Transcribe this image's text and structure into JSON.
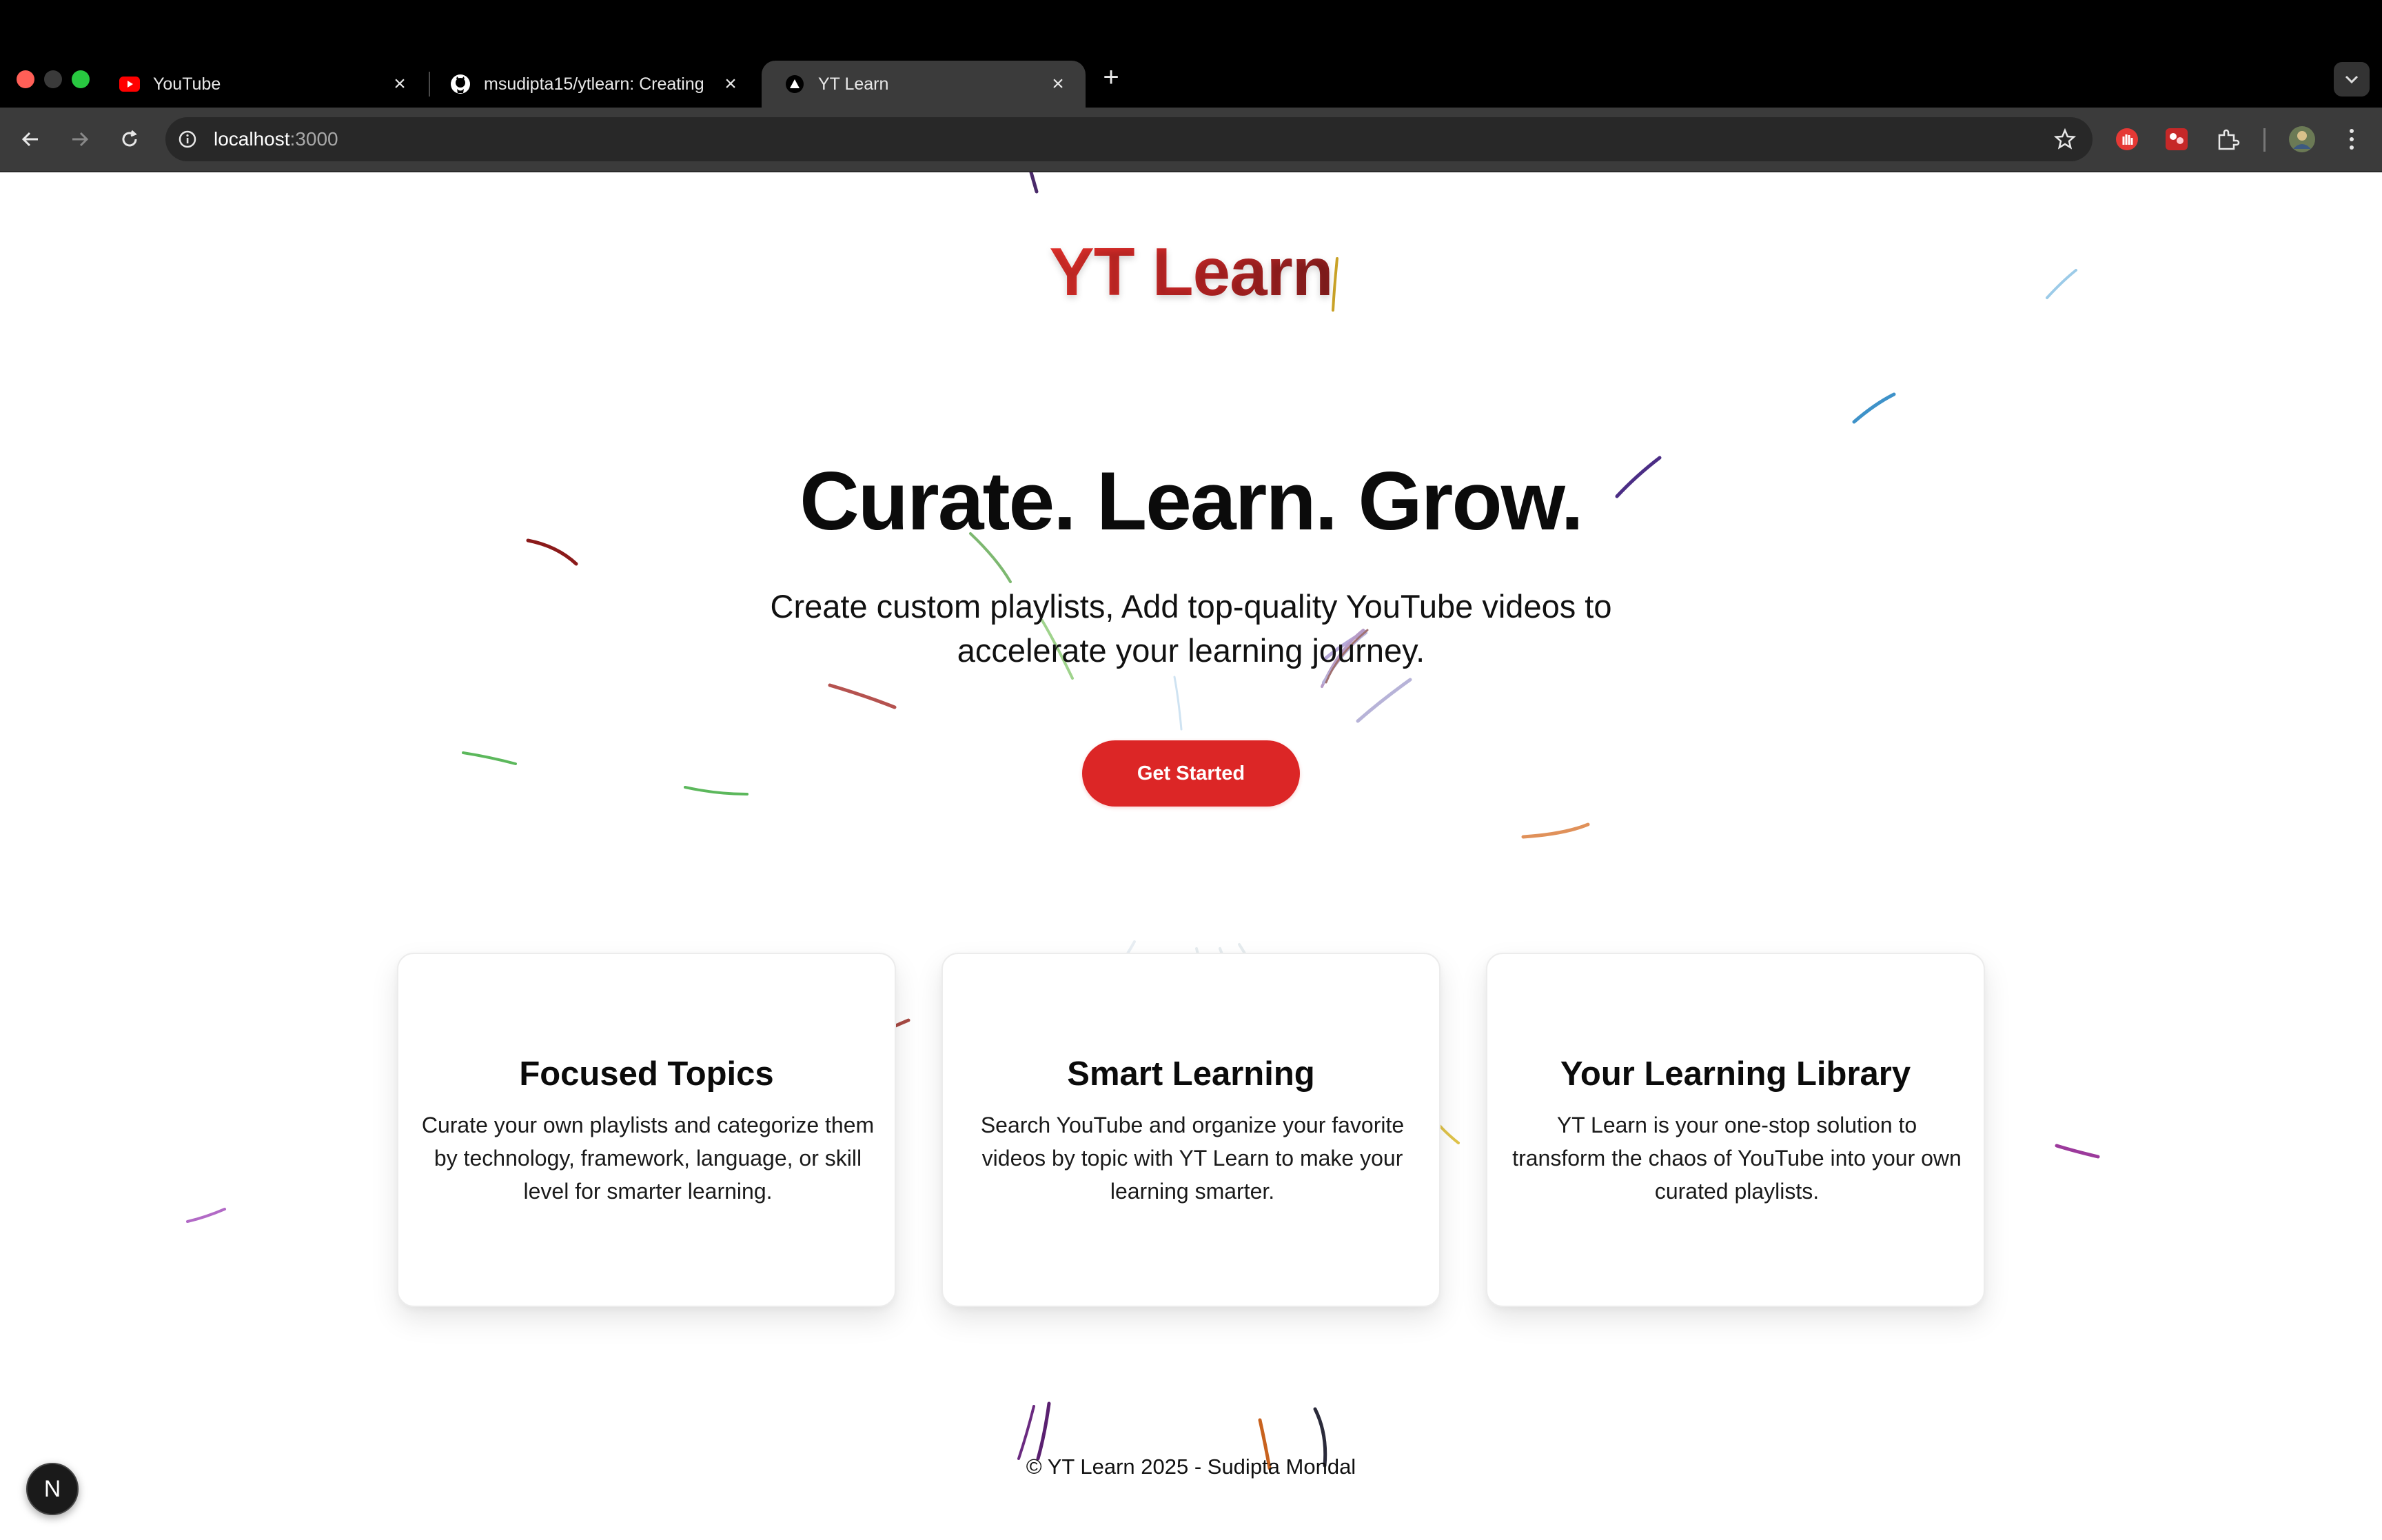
{
  "browser": {
    "tabs": [
      {
        "title": "YouTube",
        "icon": "youtube-icon"
      },
      {
        "title": "msudipta15/ytlearn: Creating",
        "icon": "github-icon"
      },
      {
        "title": "YT Learn",
        "icon": "nextjs-triangle-icon",
        "active": true
      }
    ],
    "url": {
      "host": "localhost",
      "port": ":3000"
    }
  },
  "page": {
    "brand": "YT Learn",
    "hero": {
      "title": "Curate. Learn. Grow.",
      "subtitle": "Create custom playlists, Add top-quality YouTube videos to accelerate your learning journey.",
      "cta": "Get Started"
    },
    "features": [
      {
        "title": "Focused Topics",
        "text": "Curate your own playlists and categorize them by technology, framework, language, or skill level for smarter learning."
      },
      {
        "title": "Smart Learning",
        "text": "Search YouTube and organize your favorite videos by topic with YT Learn to make your learning smarter."
      },
      {
        "title": "Your Learning Library",
        "text": "YT Learn is your one-stop solution to transform the chaos of YouTube into your own curated playlists."
      }
    ],
    "footer": "© YT Learn 2025 - Sudipta Mondal",
    "dev_badge": "N"
  },
  "colors": {
    "accent": "#dc2626",
    "brand_gradient": [
      "#e8312c",
      "#8f1f1f"
    ],
    "chrome_bg": "#000000",
    "toolbar_bg": "#3b3b3b"
  }
}
